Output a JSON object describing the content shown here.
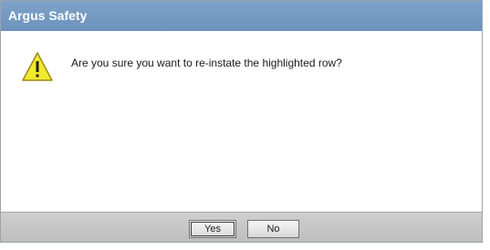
{
  "dialog": {
    "title": "Argus Safety",
    "message": "Are you sure you want to re-instate the highlighted row?",
    "icon": "warning-icon",
    "buttons": {
      "yes_label": "Yes",
      "no_label": "No"
    },
    "colors": {
      "titlebar": "#7ea2c8",
      "warning_yellow": "#f2ea2b",
      "footer": "#c7c7c7"
    }
  }
}
